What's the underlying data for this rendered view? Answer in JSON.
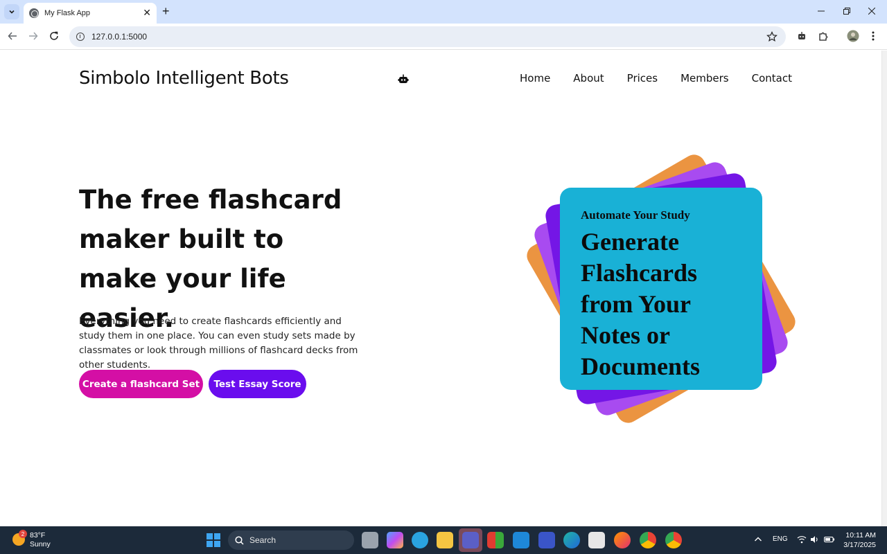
{
  "browser": {
    "tab_title": "My Flask App",
    "url": "127.0.0.1:5000"
  },
  "site": {
    "brand": "Simbolo Intelligent Bots",
    "nav": [
      "Home",
      "About",
      "Prices",
      "Members",
      "Contact"
    ]
  },
  "hero": {
    "title": "The free flashcard maker built to make your life easier.",
    "description": "Everything you need to create flashcards efficiently and study them in one place. You can even study sets made by classmates or look through millions of flashcard decks from other students.",
    "btn_create": "Create a flashcard Set",
    "btn_essay": "Test Essay Score"
  },
  "card": {
    "kicker": "Automate Your Study",
    "headline": "Generate Flashcards from Your Notes or Documents"
  },
  "taskbar": {
    "weather_temp": "83°F",
    "weather_cond": "Sunny",
    "weather_badge": "2",
    "search": "Search",
    "lang": "ENG",
    "time": "10:11 AM",
    "date": "3/17/2025"
  },
  "colors": {
    "btn_create": "#d40fa5",
    "btn_essay": "#6a0dee",
    "card_front": "#19b1d6",
    "card_orange": "#eb9441",
    "card_lavender": "#a84bf0",
    "card_purple": "#7416e6"
  }
}
